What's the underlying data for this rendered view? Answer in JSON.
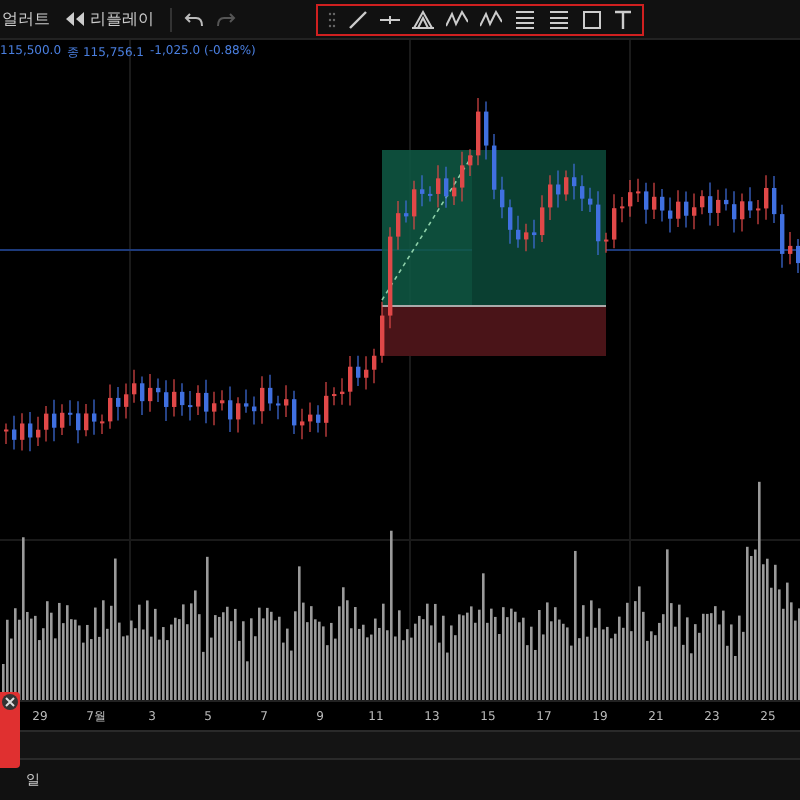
{
  "toolbar": {
    "alert_label": "얼러트",
    "replay_label": "리플레이",
    "undo_enabled": true,
    "redo_enabled": false
  },
  "drawing_tools": [
    {
      "kind": "grip"
    },
    {
      "kind": "line"
    },
    {
      "kind": "hline"
    },
    {
      "kind": "pitchfork"
    },
    {
      "kind": "wave"
    },
    {
      "kind": "wave"
    },
    {
      "kind": "fib"
    },
    {
      "kind": "fib"
    },
    {
      "kind": "rect"
    },
    {
      "kind": "text"
    }
  ],
  "quote": {
    "open": "115,500.0",
    "close_label": "종",
    "close": "115,756.1",
    "change": "-1,025.0 (-0.88%)"
  },
  "x_axis": [
    "29",
    "7월",
    "3",
    "5",
    "7",
    "9",
    "11",
    "13",
    "15",
    "17",
    "19",
    "21",
    "23",
    "25"
  ],
  "bottom_label": "일"
}
